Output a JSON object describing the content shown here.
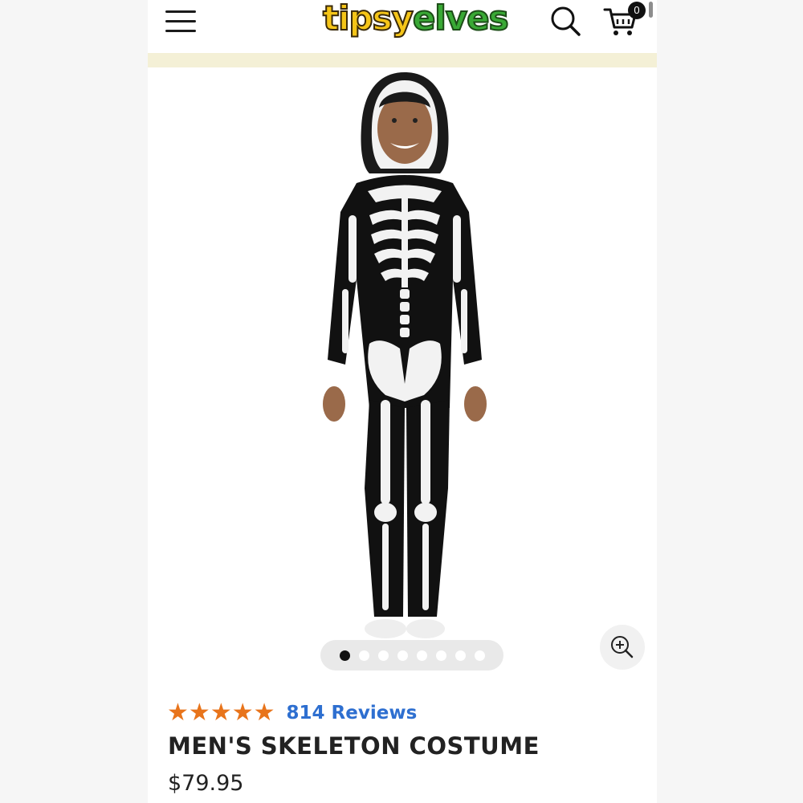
{
  "header": {
    "logo_part1": "tipsy",
    "logo_part2": "elves",
    "cart_count": "0"
  },
  "icons": {
    "menu": "hamburger-menu-icon",
    "search": "search-icon",
    "cart": "shopping-cart-icon",
    "zoom": "zoom-in-icon"
  },
  "gallery": {
    "image": "man wearing black hooded onesie with white skeleton print",
    "dot_count": 8,
    "active_dot": 0
  },
  "product": {
    "stars": [
      "★",
      "★",
      "★",
      "★",
      "★"
    ],
    "reviews": "814 Reviews",
    "title": "MEN'S SKELETON COSTUME",
    "price": "$79.95"
  },
  "colors": {
    "star": "#e8741b",
    "reviews_link": "#2e6fd0",
    "header_bar": "#f4f0d6"
  }
}
